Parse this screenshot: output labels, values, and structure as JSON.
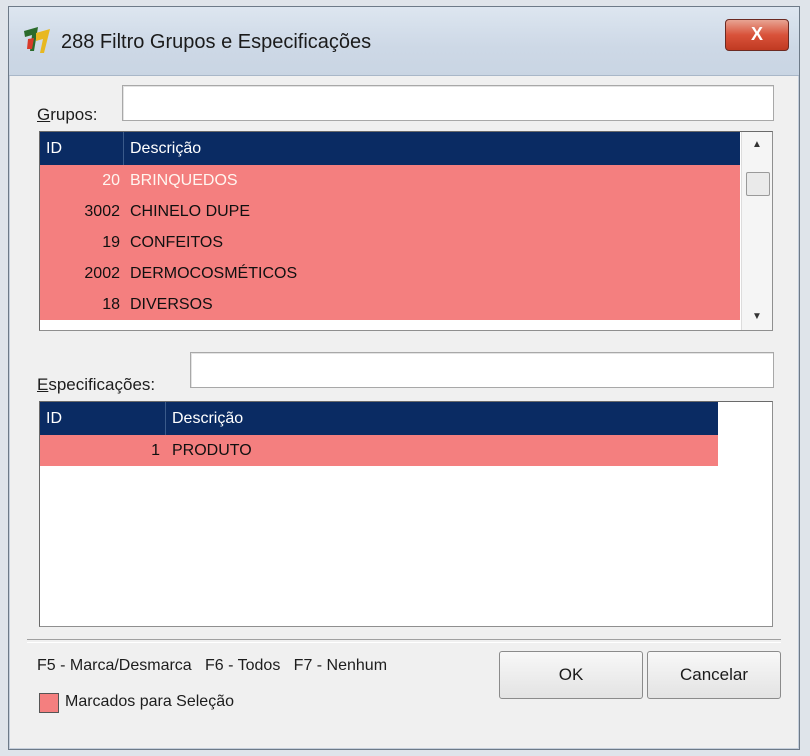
{
  "window": {
    "title": "288 Filtro Grupos e Especificações",
    "close_glyph": "X"
  },
  "grupos": {
    "label_accel": "G",
    "label_rest": "rupos:",
    "filter_value": "",
    "columns": {
      "id": "ID",
      "desc": "Descrição"
    },
    "rows": [
      {
        "id": "20",
        "desc": "BRINQUEDOS"
      },
      {
        "id": "3002",
        "desc": "CHINELO DUPE"
      },
      {
        "id": "19",
        "desc": "CONFEITOS"
      },
      {
        "id": "2002",
        "desc": "DERMOCOSMÉTICOS"
      },
      {
        "id": "18",
        "desc": "DIVERSOS"
      }
    ],
    "scroll_up_glyph": "▲",
    "scroll_down_glyph": "▼"
  },
  "especificacoes": {
    "label_accel": "E",
    "label_rest": "specificações:",
    "filter_value": "",
    "columns": {
      "id": "ID",
      "desc": "Descrição"
    },
    "rows": [
      {
        "id": "1",
        "desc": "PRODUTO"
      }
    ]
  },
  "footer": {
    "hotkeys": "F5 - Marca/Desmarca   F6 - Todos   F7 - Nenhum",
    "legend": "Marcados para Seleção",
    "ok_label": "OK",
    "cancel_label": "Cancelar"
  },
  "colors": {
    "header_bg": "#0a2b63",
    "marked_row": "#f47f7f"
  },
  "icons": {
    "app": "app-logo-icon",
    "close": "close-icon"
  }
}
